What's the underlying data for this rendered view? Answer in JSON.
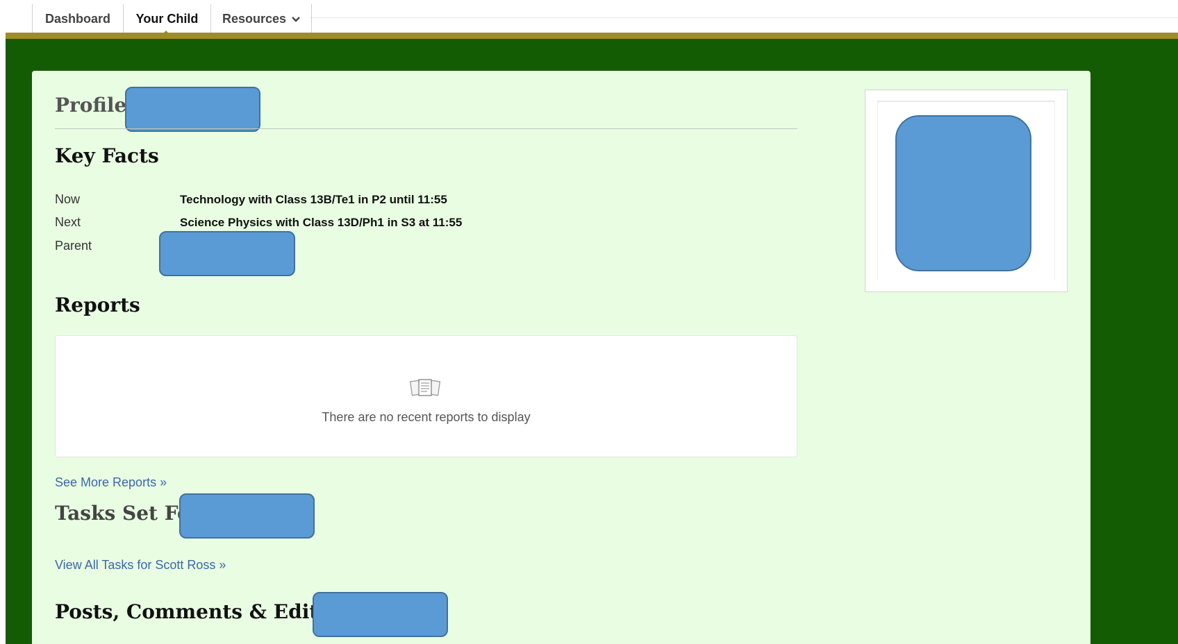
{
  "nav": {
    "tabs": [
      {
        "label": "Dashboard"
      },
      {
        "label": "Your Child"
      },
      {
        "label": "Resources"
      }
    ],
    "active_tab": "Your Child"
  },
  "colors": {
    "nav_accent": "#a08b28",
    "page_background": "#145c03",
    "panel_background": "#e8fde2",
    "link": "#3b67a8",
    "redaction_fill": "#5b9bd5"
  },
  "profile": {
    "heading": "Profile:"
  },
  "key_facts": {
    "heading": "Key Facts",
    "rows": [
      {
        "label": "Now",
        "value": "Technology with Class 13B/Te1 in P2 until 11:55"
      },
      {
        "label": "Next",
        "value": "Science Physics with Class 13D/Ph1 in S3 at 11:55"
      },
      {
        "label": "Parent",
        "value": ""
      }
    ]
  },
  "reports": {
    "heading": "Reports",
    "empty_message": "There are no recent reports to display",
    "icon": "reports-icon",
    "more_link": "See More Reports »"
  },
  "tasks": {
    "heading": "Tasks Set For",
    "view_all_link": "View All Tasks for Scott Ross »"
  },
  "posts": {
    "heading": "Posts, Comments & Edits by"
  }
}
